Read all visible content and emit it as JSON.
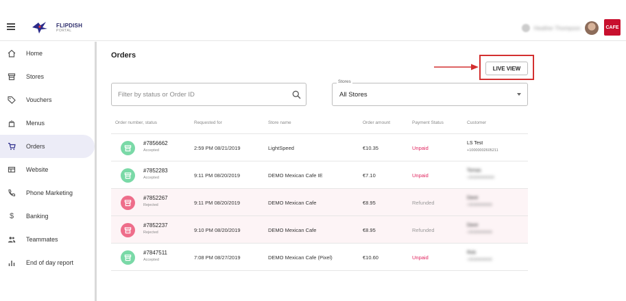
{
  "app": {
    "brand": "FLIPDISH",
    "brand_sub": "PORTAL",
    "user_name": "Heather Thompson",
    "store_logo_text": "CAFE"
  },
  "nav": {
    "items": [
      {
        "label": "Home",
        "icon": "home-icon"
      },
      {
        "label": "Stores",
        "icon": "store-icon"
      },
      {
        "label": "Vouchers",
        "icon": "tag-icon"
      },
      {
        "label": "Menus",
        "icon": "menu-book-icon"
      },
      {
        "label": "Orders",
        "icon": "cart-icon",
        "active": true
      },
      {
        "label": "Website",
        "icon": "website-icon"
      },
      {
        "label": "Phone Marketing",
        "icon": "phone-icon"
      },
      {
        "label": "Banking",
        "icon": "dollar-icon"
      },
      {
        "label": "Teammates",
        "icon": "people-icon"
      },
      {
        "label": "End of day report",
        "icon": "bar-chart-icon"
      }
    ]
  },
  "page": {
    "title": "Orders",
    "live_view_label": "LIVE VIEW"
  },
  "filters": {
    "search_placeholder": "Filter by status or Order ID",
    "search_value": "",
    "stores_label": "Stores",
    "stores_value": "All Stores"
  },
  "table": {
    "headers": [
      "Order number, status",
      "Requested for",
      "Store name",
      "Order amount",
      "Payment Status",
      "Customer"
    ],
    "rows": [
      {
        "order": "#7856662",
        "status": "Accepted",
        "requested": "2:59 PM 08/21/2019",
        "store": "LightSpeed",
        "amount": "€10.35",
        "payment": "Unpaid",
        "customer": "LS Test",
        "phone": "+10000002605211"
      },
      {
        "order": "#7852283",
        "status": "Accepted",
        "requested": "9:11 PM 08/20/2019",
        "store": "DEMO Mexican Cafe IE",
        "amount": "€7.10",
        "payment": "Unpaid",
        "customer": "Tomas",
        "phone": "+353000000000"
      },
      {
        "order": "#7852267",
        "status": "Rejected",
        "requested": "9:11 PM 08/20/2019",
        "store": "DEMO Mexican Cafe",
        "amount": "€8.95",
        "payment": "Refunded",
        "customer": "Dave",
        "phone": "+35300000000"
      },
      {
        "order": "#7852237",
        "status": "Rejected",
        "requested": "9:10 PM 08/20/2019",
        "store": "DEMO Mexican Cafe",
        "amount": "€8.95",
        "payment": "Refunded",
        "customer": "Dave",
        "phone": "+35300000000"
      },
      {
        "order": "#7847511",
        "status": "Accepted",
        "requested": "7:08 PM 08/27/2019",
        "store": "DEMO Mexican Cafe (Pixel)",
        "amount": "€10.60",
        "payment": "Unpaid",
        "customer": "Rob",
        "phone": "+35300000000"
      }
    ]
  },
  "colors": {
    "accepted": "#7ad9a7",
    "rejected": "#ee6d8a",
    "unpaid": "#e0245e",
    "annotation_red": "#d32f2f",
    "brand_navy": "#2a2a6a"
  }
}
